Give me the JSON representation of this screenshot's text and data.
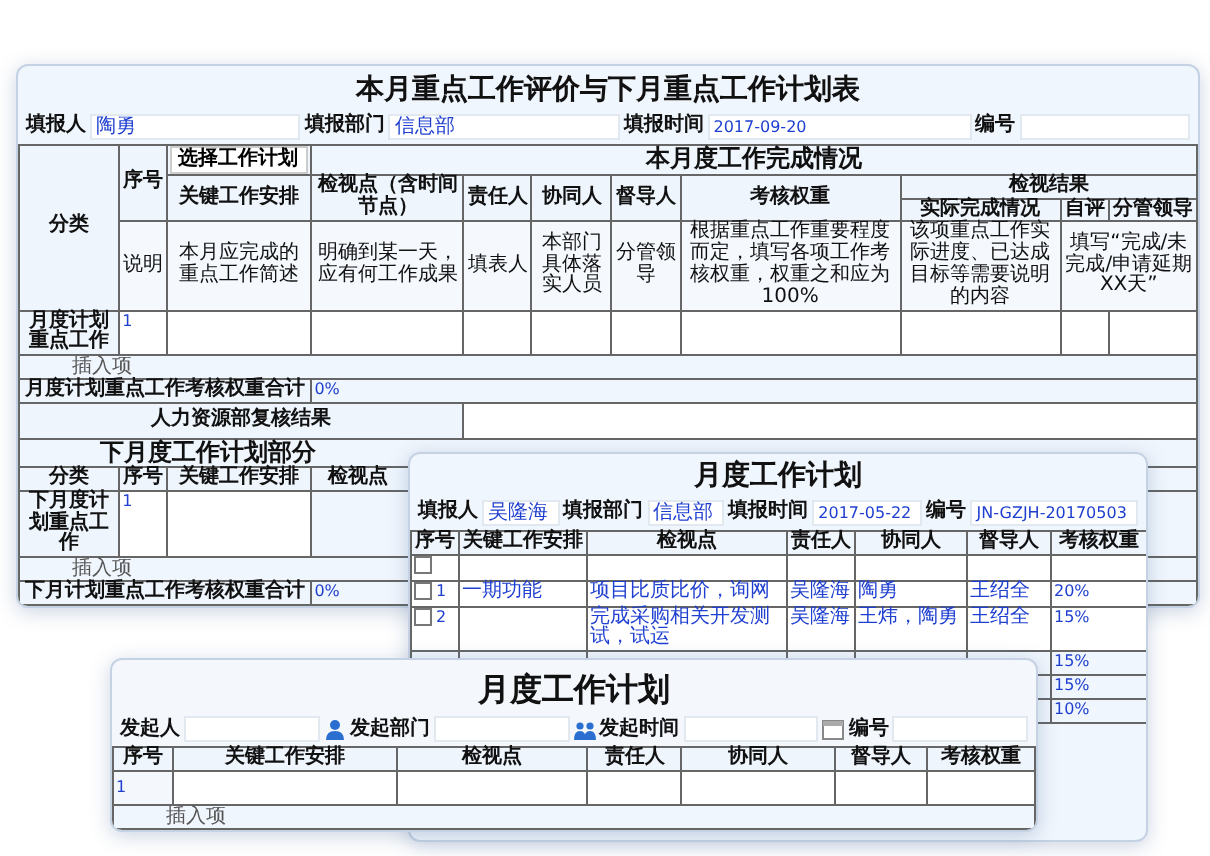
{
  "evaluation_form": {
    "title": "本月重点工作评价与下月重点工作计划表",
    "fields": [
      {
        "label": "填报人",
        "value": "陶勇"
      },
      {
        "label": "填报部门",
        "value": "信息部"
      },
      {
        "label": "填报时间",
        "value": "2017-09-20"
      },
      {
        "label": "编号"
      }
    ],
    "category_header": "分类",
    "index_header": "序号",
    "select_plan_button": "选择工作计划",
    "section_title": "本月度工作完成情况",
    "columns": [
      "关键工作安排",
      "检视点（含时间节点）",
      "责任人",
      "协同人",
      "督导人",
      "考核权重"
    ],
    "result_group": "检视结果",
    "result_columns": [
      "实际完成情况",
      "自评",
      "分管领导"
    ],
    "note_label": "说明",
    "notes": [
      "本月应完成的重点工作简述",
      "明确到某一天，应有何工作成果",
      "填表人",
      "本部门具体落实人员",
      "分管领导",
      "根据重点工作重要程度而定，填写各项工作考核权重，权重之和应为100%",
      "该项重点工作实际进度、已达成目标等需要说明的内容",
      "填写“完成/未完成/申请延期XX天”"
    ],
    "plan_category": "月度计划重点工作",
    "plan_index": "1",
    "insert_link": "插入项",
    "total_label": "月度计划重点工作考核权重合计",
    "total_value": "0%",
    "review_label": "人力资源部复核结果",
    "next_month": {
      "title": "下月度工作计划部分",
      "columns": [
        "分类",
        "序号",
        "关键工作安排",
        "检视点"
      ],
      "category": "下月度计划重点工作",
      "index": "1",
      "insert_link": "插入项",
      "total_label": "下月计划重点工作考核权重合计",
      "total_value": "0%"
    }
  },
  "plan_window": {
    "title": "月度工作计划",
    "fields": [
      {
        "label": "填报人",
        "value": "吴隆海"
      },
      {
        "label": "填报部门",
        "value": "信息部"
      },
      {
        "label": "填报时间",
        "value": "2017-05-22"
      },
      {
        "label": "编号",
        "value": "JN-GZJH-20170503"
      }
    ],
    "columns": [
      "序号",
      "关键工作安排",
      "检视点",
      "责任人",
      "协同人",
      "督导人",
      "考核权重"
    ],
    "rows": [
      {
        "checked": false
      },
      {
        "checked": false,
        "index": "1",
        "task": "一期功能",
        "checkpoint": "项目比质比价，询网",
        "owner": "吴隆海",
        "partner": "陶勇",
        "supervisor": "王绍全",
        "weight": "20%"
      },
      {
        "checked": false,
        "index": "2",
        "checkpoint": "完成采购相关开发测试，试运",
        "owner": "吴隆海",
        "partner": "王炜，陶勇",
        "supervisor": "王绍全",
        "weight": "15%"
      },
      {
        "weight": "15%"
      },
      {
        "weight": "15%"
      },
      {
        "weight": "10%"
      }
    ]
  },
  "new_plan_window": {
    "title": "月度工作计划",
    "fields": [
      {
        "label": "发起人",
        "kind": "user"
      },
      {
        "label": "发起部门",
        "kind": "department"
      },
      {
        "label": "发起时间",
        "kind": "date"
      },
      {
        "label": "编号",
        "kind": "text"
      }
    ],
    "columns": [
      "序号",
      "关键工作安排",
      "检视点",
      "责任人",
      "协同人",
      "督导人",
      "考核权重"
    ],
    "rows": [
      {
        "index": "1"
      }
    ],
    "insert_link": "插入项"
  }
}
